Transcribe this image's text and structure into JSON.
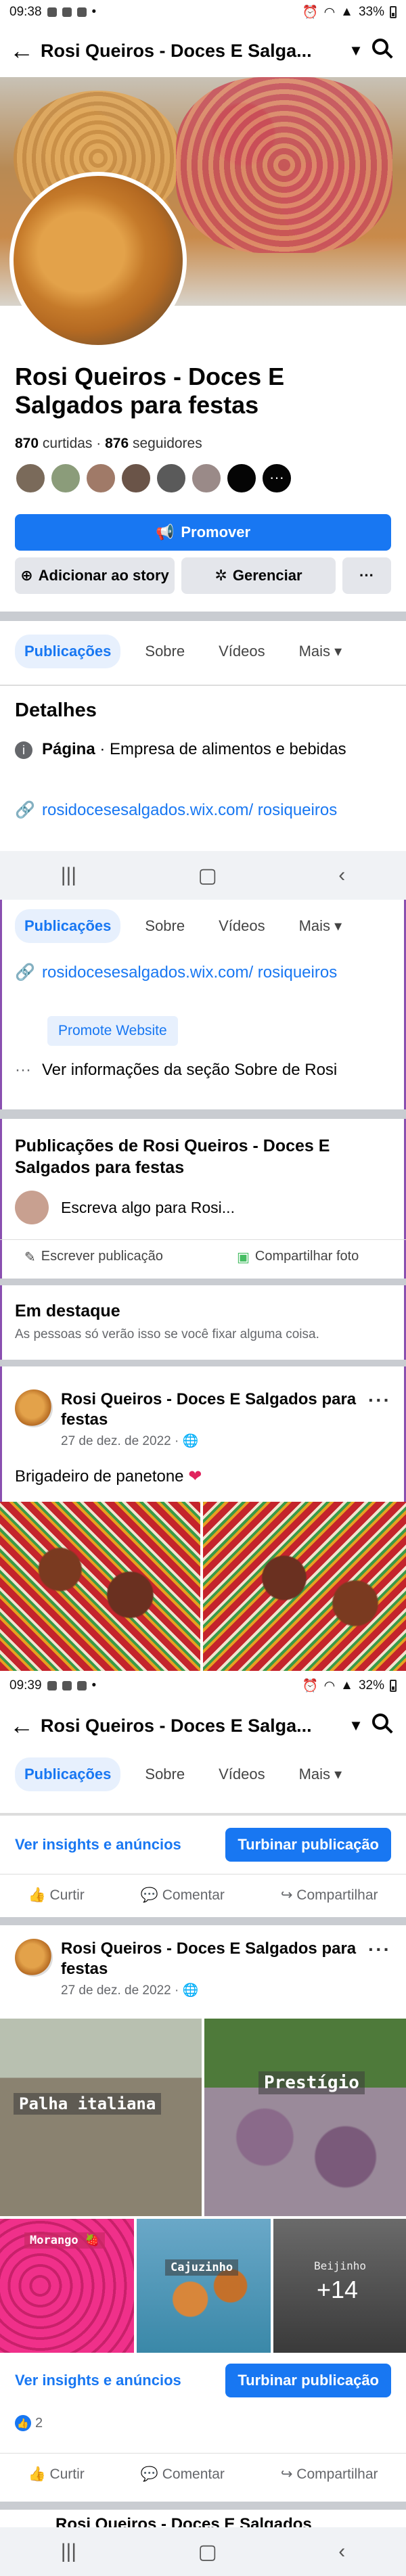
{
  "status1": {
    "time": "09:38",
    "battery": "33%"
  },
  "status2": {
    "time": "09:39",
    "battery": "32%"
  },
  "topbar": {
    "title": "Rosi Queiros - Doces E Salga..."
  },
  "page": {
    "name": "Rosi Queiros - Doces E Salgados para festas",
    "likes_count": "870",
    "likes_label": "curtidas",
    "followers_count": "876",
    "followers_label": "seguidores"
  },
  "buttons": {
    "promote": "Promover",
    "add_story": "Adicionar ao story",
    "manage": "Gerenciar",
    "more": "···"
  },
  "tabs": [
    "Publicações",
    "Sobre",
    "Vídeos",
    "Mais"
  ],
  "details": {
    "title": "Detalhes",
    "category_label": "Página",
    "category_value": " · Empresa de alimentos e bebidas",
    "website": "rosidocesesalgados.wix.com/ rosiqueiros",
    "promote_website": "Promote Website",
    "see_about": "Ver informações da seção Sobre de Rosi"
  },
  "composer": {
    "title": "Publicações de Rosi Queiros - Doces E Salgados para festas",
    "placeholder": "Escreva algo para Rosi...",
    "write_post": "Escrever publicação",
    "share_photo": "Compartilhar foto"
  },
  "featured": {
    "title": "Em destaque",
    "subtitle": "As pessoas só verão isso se você fixar alguma coisa."
  },
  "post1": {
    "author": "Rosi Queiros - Doces E Salgados para festas",
    "date": "27 de dez. de 2022 · ",
    "text": "Brigadeiro de panetone"
  },
  "post2": {
    "author": "Rosi Queiros - Doces E Salgados para festas",
    "date": "27 de dez. de 2022 · ",
    "photo_labels": [
      "Palha italiana",
      "Prestígio",
      "Morango",
      "Cajuzinho",
      "Beijinho"
    ],
    "more_photos": "+14",
    "reactions": "2"
  },
  "post_actions": {
    "insights": "Ver insights e anúncios",
    "boost": "Turbinar publicação",
    "like": "Curtir",
    "comment": "Comentar",
    "share": "Compartilhar"
  },
  "next_post_author": "Rosi Queiros - Doces E Salgados"
}
